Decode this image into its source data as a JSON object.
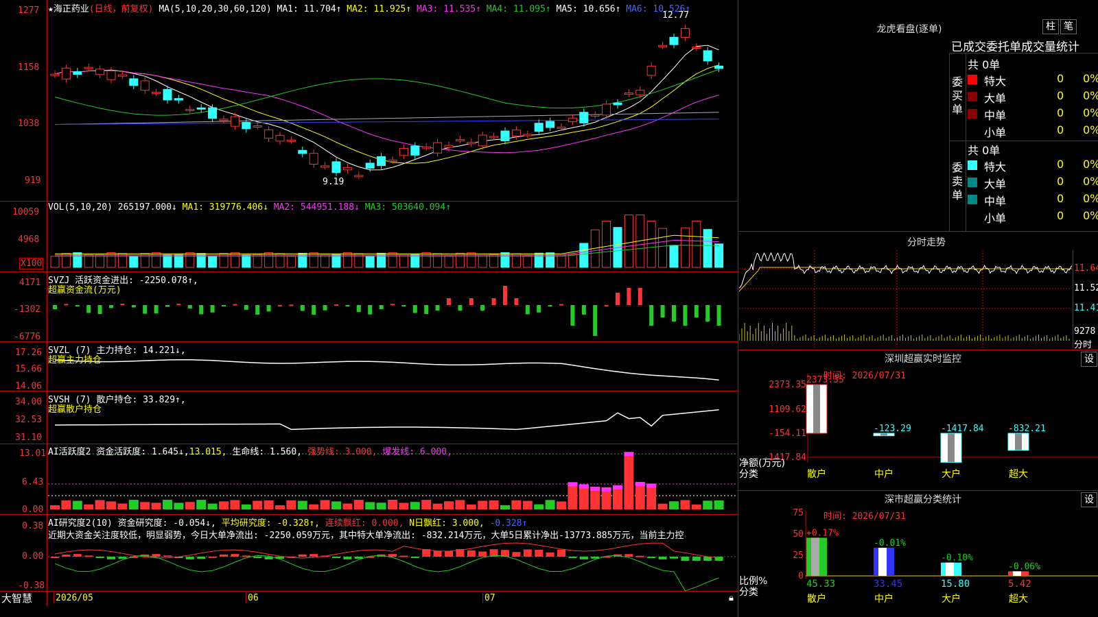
{
  "stock": {
    "star": "★",
    "name": "海正药业",
    "period": "(日线，前复权)",
    "ma_label": "MA(5,10,20,30,60,120)",
    "ma1": "MA1: 11.704↑",
    "ma2": "MA2: 11.925↑",
    "ma3": "MA3: 11.535↑",
    "ma4": "MA4: 11.095↑",
    "ma5": "MA5: 10.656↑",
    "ma6": "MA6: 10.526↑",
    "high_mark": "12.77",
    "low_mark": "9.19",
    "y_labels": [
      "1277",
      "1158",
      "1038",
      "919"
    ]
  },
  "vol": {
    "label": "VOL(5,10,20)",
    "value": "265197.000↓",
    "ma1": "MA1: 319776.406↓",
    "ma2": "MA2: 544951.188↓",
    "ma3": "MA3: 503640.094↑",
    "y_labels": [
      "10059",
      "4968",
      "X100"
    ]
  },
  "svzj": {
    "line1": "SVZJ  活跃资金进出: -2250.078↑,",
    "line2": "超赢资金流(万元)",
    "y_labels": [
      "4171",
      "-1302",
      "-6776"
    ]
  },
  "svzl": {
    "line1": "SVZL (7) 主力持仓: 14.221↓,",
    "line2": "超赢主力持仓",
    "y_labels": [
      "17.26",
      "15.66",
      "14.06"
    ]
  },
  "svsh": {
    "line1": "SVSH (7) 散户持仓: 33.829↑,",
    "line2": "超赢散户持仓",
    "y_labels": [
      "34.00",
      "32.53",
      "31.10"
    ]
  },
  "ai1": {
    "prefix": "AI活跃度2 资金活跃度: 1.645↓,",
    "v2": "13.015,",
    "v3": "生命线: 1.560,",
    "v4": "强势线: 3.000,",
    "v5": "爆发线: 6.000,",
    "y_labels": [
      "13.01",
      "6.43",
      "0.00"
    ]
  },
  "ai2": {
    "prefix": "AI研究度2(10) 资金研究度: -0.054↓,",
    "v2": "平均研究度: -0.328↑,",
    "v3": "连续飘红: 0.000,",
    "v4": "N日飘红: 3.000,",
    "v5": "-0.328↑",
    "text": "近期大资金关注度较低，明显弱势，今日大单净流出: -2250.059万元，其中特大单净流出: -832.214万元，大单5日累计净出-13773.885万元，当前主力控",
    "y_labels": [
      "0.38",
      "0.00",
      "-0.38"
    ]
  },
  "bottom": {
    "brand": "大智慧",
    "dates": [
      "2026/05",
      "06",
      "07"
    ]
  },
  "right": {
    "title": "龙虎看盘(逐单)",
    "btn_zhu": "柱",
    "btn_bi": "笔",
    "header": "已成交委托单成交量统计",
    "buy_label": "委买单",
    "sell_label": "委卖单",
    "buy_total": "共 0单",
    "sell_total": "共 0单",
    "rows": [
      "特大",
      "大单",
      "中单",
      "小单"
    ],
    "zero": "0",
    "pct": "0%"
  },
  "fenshi": {
    "title": "分时走势",
    "y_labels": [
      "11.64",
      "11.52",
      "11.41",
      "9278",
      "分时"
    ]
  },
  "sz_monitor": {
    "title": "深圳超赢实时监控",
    "settings": "设",
    "time": "时间: 2026/07/31",
    "y_labels": [
      "2373.35",
      "1109.62",
      "-154.11",
      "-1417.84"
    ],
    "values": [
      "2373.35",
      "-123.29",
      "-1417.84",
      "-832.21"
    ],
    "categories": [
      "散户",
      "中户",
      "大户",
      "超大"
    ],
    "ylabel1": "净额(万元)",
    "ylabel2": "分类"
  },
  "sz_class": {
    "title": "深市超赢分类统计",
    "settings": "设",
    "time": "时间: 2026/07/31",
    "y_labels": [
      "75",
      "50",
      "25",
      "0"
    ],
    "top_values": [
      "+0.17%",
      "-0.01%",
      "-0.10%",
      "-0.06%"
    ],
    "bottom_values": [
      "45.33",
      "33.45",
      "15.80",
      "5.42"
    ],
    "categories": [
      "散户",
      "中户",
      "大户",
      "超大"
    ],
    "ylabel1": "比例%",
    "ylabel2": "分类"
  },
  "colors": {
    "up": "#ff3333",
    "down": "#33ffff",
    "grid": "#cc0000",
    "yellow": "#ffff00",
    "magenta": "#ff33ff",
    "green": "#22cc22"
  }
}
